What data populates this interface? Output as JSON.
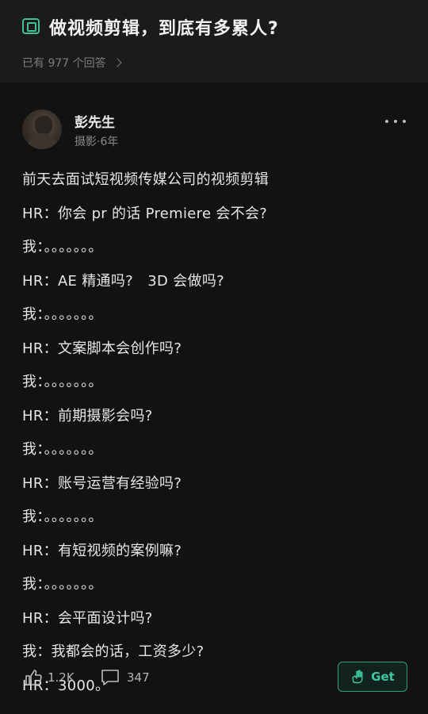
{
  "question": {
    "icon": "question-box-icon",
    "title": "做视频剪辑，到底有多累人?",
    "answers_text": "已有 977 个回答"
  },
  "author": {
    "name": "彭先生",
    "meta": "摄影·6年"
  },
  "answer_lines": [
    "前天去面试短视频传媒公司的视频剪辑",
    "HR：你会 pr 的话 Premiere 会不会?",
    "我：。。。。。。。",
    "HR：AE 精通吗?　3D 会做吗?",
    "我：。。。。。。。",
    "HR：文案脚本会创作吗?",
    "我：。。。。。。。",
    "HR：前期摄影会吗?",
    "我：。。。。。。。",
    "HR：账号运营有经验吗?",
    "我：。。。。。。。",
    "HR：有短视频的案例嘛?",
    "我：。。。。。。。",
    "HR：会平面设计吗?",
    "我：我都会的话，工资多少?",
    "HR：3000。"
  ],
  "actions": {
    "likes": "1.2K",
    "comments": "347",
    "get_label": "Get"
  },
  "colors": {
    "accent": "#3fc79e",
    "background": "#121212",
    "header_bg": "#1b1b1b"
  }
}
